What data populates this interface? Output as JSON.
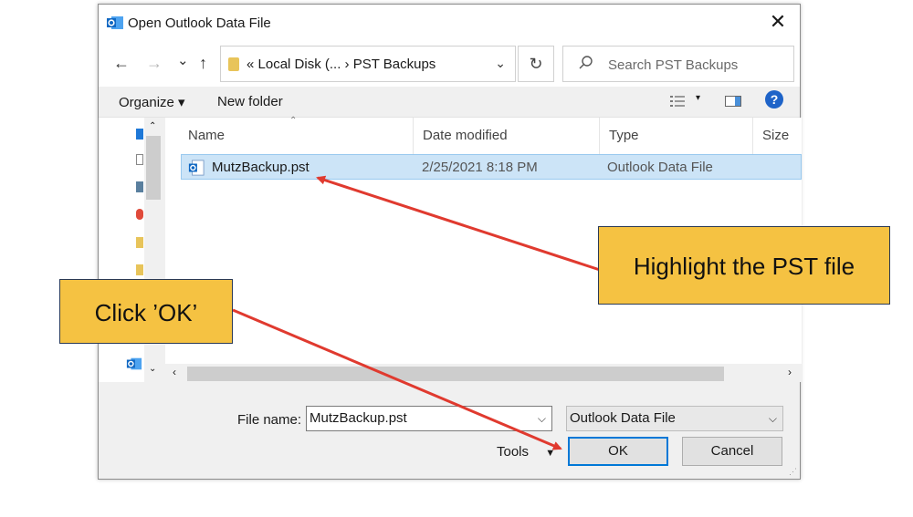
{
  "window": {
    "title": "Open Outlook Data File",
    "close_glyph": "✕"
  },
  "nav": {
    "back_glyph": "←",
    "forward_glyph": "→",
    "recent_glyph": "⌄",
    "up_glyph": "↑",
    "address": "«  Local Disk (...  ›  PST Backups",
    "address_dropdown": "⌄",
    "refresh_glyph": "↻",
    "search_placeholder": "Search PST Backups",
    "search_icon": "search-icon"
  },
  "toolbar": {
    "organize_label": "Organize ▾",
    "new_folder_label": "New folder",
    "help_label": "?"
  },
  "columns": {
    "name": "Name",
    "date_modified": "Date modified",
    "type": "Type",
    "size": "Size"
  },
  "files": [
    {
      "name": "MutzBackup.pst",
      "date_modified": "2/25/2021 8:18 PM",
      "type": "Outlook Data File"
    }
  ],
  "footer": {
    "file_name_label": "File name:",
    "file_name_value": "MutzBackup.pst",
    "file_type_value": "Outlook Data File",
    "tools_label": "Tools",
    "ok_label": "OK",
    "cancel_label": "Cancel"
  },
  "callouts": {
    "highlight": "Highlight the PST file",
    "click_ok": "Click ’OK’"
  },
  "colors": {
    "callout_fill": "#f5c242",
    "arrow": "#e03a2f",
    "selection": "#cce4f7",
    "outlook_blue": "#0f67c2"
  }
}
